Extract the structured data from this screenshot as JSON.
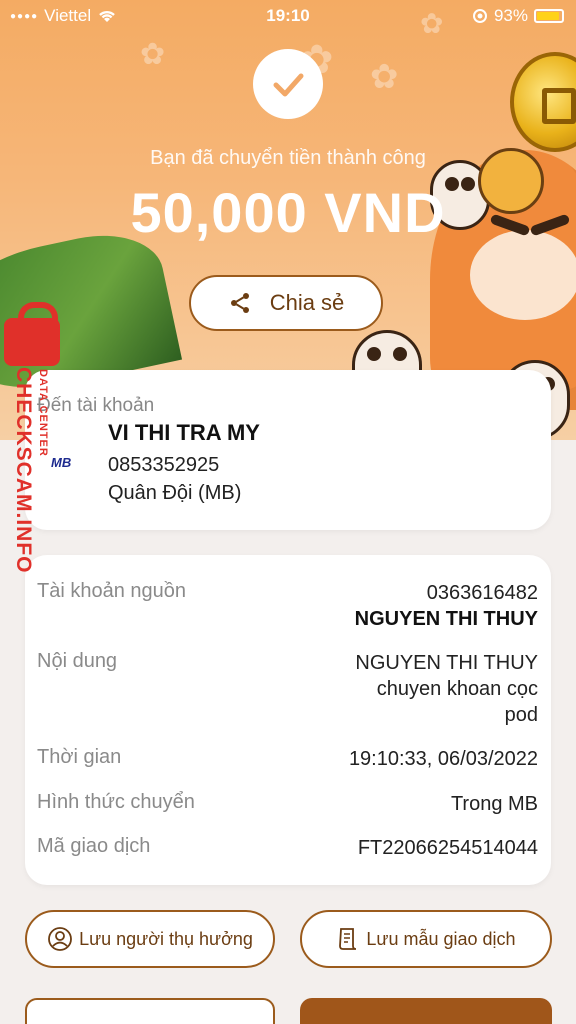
{
  "status_bar": {
    "carrier": "Viettel",
    "time": "19:10",
    "battery": "93%"
  },
  "success": {
    "message": "Bạn đã chuyển tiền thành công",
    "amount": "50,000 VND",
    "share_label": "Chia sẻ"
  },
  "recipient": {
    "label": "Đến tài khoản",
    "name": "VI THI TRA MY",
    "account": "0853352925",
    "bank": "Quân Đội (MB)",
    "bank_logo": "MB"
  },
  "details": {
    "source_label": "Tài khoản nguồn",
    "source_account": "0363616482",
    "source_name": "NGUYEN THI THUY",
    "content_label": "Nội dung",
    "content_line1": "NGUYEN THI THUY",
    "content_line2": "chuyen khoan cọc",
    "content_line3": "pod",
    "time_label": "Thời gian",
    "time_value": "19:10:33, 06/03/2022",
    "method_label": "Hình thức chuyển",
    "method_value": "Trong MB",
    "txn_label": "Mã giao dịch",
    "txn_value": "FT22066254514044"
  },
  "actions": {
    "save_recipient": "Lưu người thụ hưởng",
    "save_template": "Lưu mẫu giao dịch"
  },
  "watermark": {
    "main": "CHECKSCAM.INFO",
    "sub": "DATA CENTER"
  },
  "colors": {
    "accent": "#9b5b1c",
    "hero_top": "#f4ab63",
    "watermark": "#e0302a"
  }
}
